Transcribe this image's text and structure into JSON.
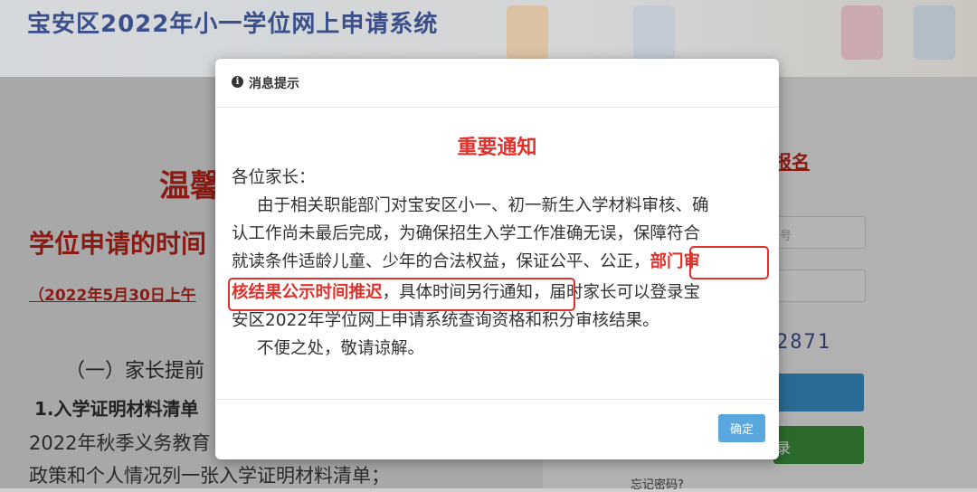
{
  "app": {
    "title": "宝安区2022年小一学位网上申请系统"
  },
  "left": {
    "welcome_title": "温馨",
    "time_heading": "学位申请的时间",
    "date_line": "（2022年5月30日上午",
    "section_heading": "（一）家长提前",
    "sub_heading": "1.入学证明材料清单",
    "body_lines": [
      "2022年秋季义务教育",
      "政策和个人情况列一张入学证明材料清单；"
    ]
  },
  "right": {
    "signup_link": "报名",
    "id_placeholder": "号",
    "captcha": "2871",
    "login_button": "录",
    "forgot_password": "忘记密码?"
  },
  "modal": {
    "header_icon": "info-icon",
    "header_title": "消息提示",
    "notice_title": "重要通知",
    "greeting": "各位家长：",
    "line1": "由于相关职能部门对宝安区小一、初一新生入学材料审核、确",
    "line2": "认工作尚未最后完成，为确保招生入学工作准确无误，保障符合",
    "line3_pre": "就读条件适龄儿童、少年的合法权益，保证公平、公正，",
    "line3_hl": "部门审",
    "line4_hl": "核结果公示时间推迟",
    "line4_post": "，具体时间另行通知，届时家长可以登录宝",
    "line5": "安区2022年学位网上申请系统查询资格和积分审核结果。",
    "line6": "不便之处，敬请谅解。",
    "ok_button": "确定"
  },
  "colors": {
    "highlight_red": "#e0312a",
    "ok_blue": "#5aa7e0",
    "title_blue": "#3b4f8a"
  }
}
